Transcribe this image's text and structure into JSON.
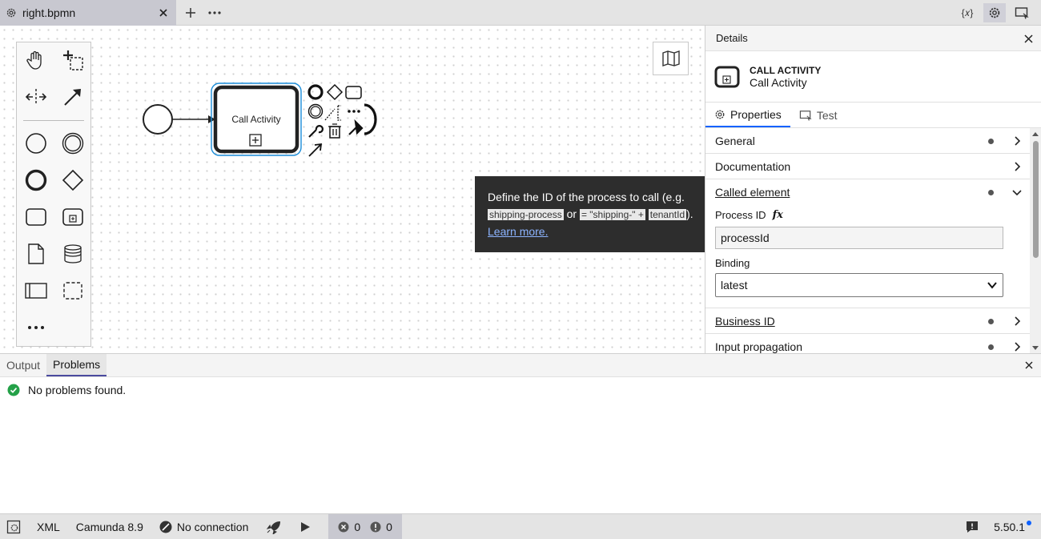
{
  "tab": {
    "title": "right.bpmn",
    "icon": "gear-icon"
  },
  "topbar": {
    "variables_label": "{𝑥}"
  },
  "canvas": {
    "call_activity_label": "Call Activity",
    "tooltip": {
      "text1": "Define the ID of the process to call (e.g.",
      "code1": "shipping-process",
      "or": "or",
      "code2": "= \"shipping-\" +",
      "code3": "tenantId",
      "end": ").",
      "link": "Learn more."
    }
  },
  "panel": {
    "title": "Details",
    "element_type": "CALL ACTIVITY",
    "element_name": "Call Activity",
    "tabs": [
      {
        "label": "Properties"
      },
      {
        "label": "Test"
      }
    ],
    "groups": {
      "general": "General",
      "documentation": "Documentation",
      "called_element": "Called element",
      "business_id": "Business ID",
      "input_propagation": "Input propagation"
    },
    "process_id_label": "Process ID",
    "fx_label": "fx",
    "process_id_value": "processId",
    "binding_label": "Binding",
    "binding_value": "latest"
  },
  "output": {
    "tabs": [
      {
        "label": "Output"
      },
      {
        "label": "Problems"
      }
    ],
    "message": "No problems found."
  },
  "statusbar": {
    "xml": "XML",
    "engine": "Camunda 8.9",
    "connection": "No connection",
    "errors": "0",
    "warnings": "0",
    "version": "5.50.1"
  }
}
